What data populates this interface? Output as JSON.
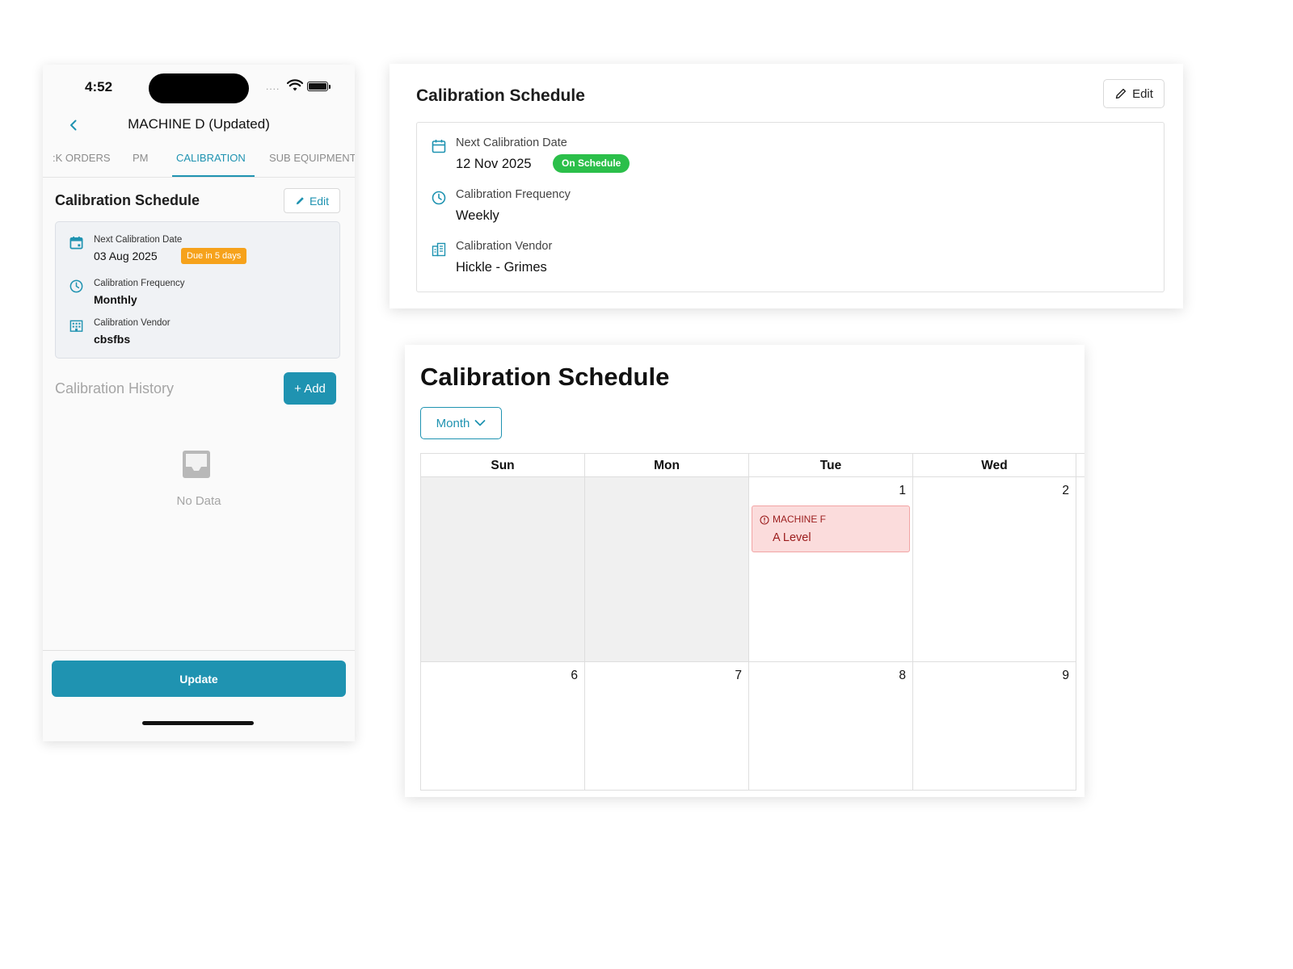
{
  "mobile": {
    "status_bar": {
      "time": "4:52",
      "signal": "....",
      "wifi_icon": "wifi-icon",
      "battery_icon": "battery-icon"
    },
    "nav": {
      "back_icon": "chevron-left-icon",
      "title": "MACHINE D (Updated)"
    },
    "tabs": [
      {
        "label": ":K ORDERS"
      },
      {
        "label": "PM"
      },
      {
        "label": "CALIBRATION",
        "active": true
      },
      {
        "label": "SUB EQUIPMENT"
      }
    ],
    "schedule": {
      "title": "Calibration Schedule",
      "edit_label": "Edit",
      "edit_icon": "pencil-icon",
      "next_date_label": "Next Calibration Date",
      "next_date_value": "03 Aug 2025",
      "due_badge": "Due in 5 days",
      "due_badge_color": "#f6a21b",
      "frequency_label": "Calibration Frequency",
      "frequency_value": "Monthly",
      "vendor_label": "Calibration Vendor",
      "vendor_value": "cbsfbs"
    },
    "history": {
      "title": "Calibration History",
      "add_label": "+ Add",
      "empty_text": "No Data",
      "empty_icon": "inbox-icon"
    },
    "footer": {
      "update_label": "Update"
    }
  },
  "desktop_summary": {
    "title": "Calibration Schedule",
    "edit_label": "Edit",
    "next_date_label": "Next Calibration Date",
    "next_date_value": "12 Nov 2025",
    "status_badge": "On Schedule",
    "status_badge_color": "#2bbf4a",
    "frequency_label": "Calibration Frequency",
    "frequency_value": "Weekly",
    "vendor_label": "Calibration Vendor",
    "vendor_value": "Hickle - Grimes"
  },
  "calendar": {
    "title": "Calibration Schedule",
    "view_select": "Month",
    "weekdays": [
      "Sun",
      "Mon",
      "Tue",
      "Wed"
    ],
    "weeks": [
      [
        "",
        "",
        "1",
        "2"
      ],
      [
        "6",
        "7",
        "8",
        "9"
      ]
    ],
    "event": {
      "title": "MACHINE F",
      "subtitle": "A Level",
      "color": "#fbdcdc"
    }
  },
  "colors": {
    "accent": "#1f93b1",
    "warning": "#f6a21b",
    "success": "#2bbf4a",
    "danger": "#9b1c1c"
  }
}
